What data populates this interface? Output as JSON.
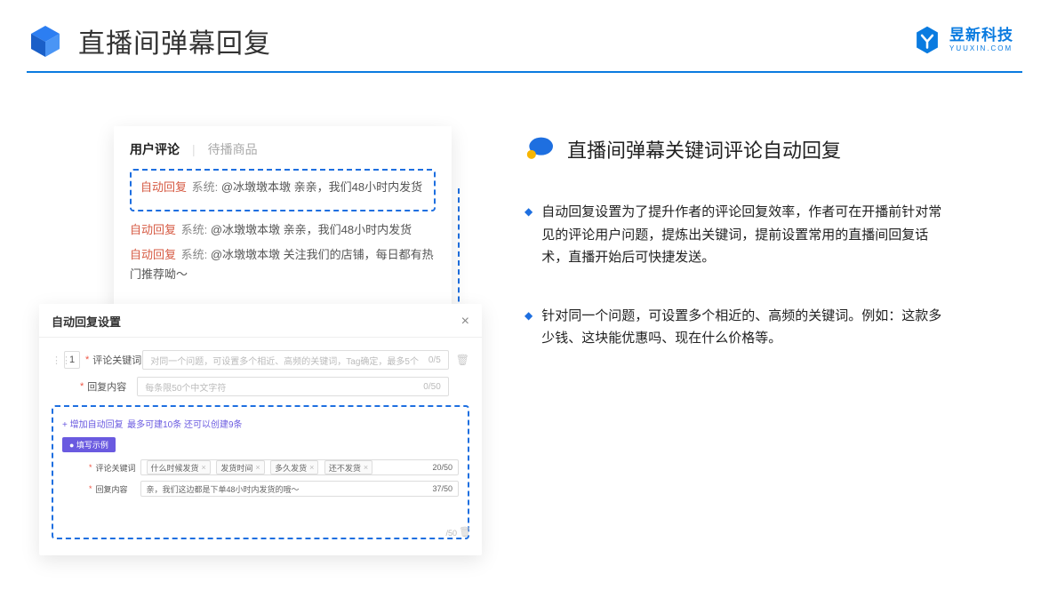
{
  "header": {
    "title": "直播间弹幕回复"
  },
  "brand": {
    "name": "昱新科技",
    "sub": "YUUXIN.COM"
  },
  "comments_card": {
    "tab_active": "用户评论",
    "tab_inactive": "待播商品",
    "highlighted": {
      "ar": "自动回复",
      "sys": " 系统: ",
      "text": "@冰墩墩本墩 亲亲，我们48小时内发货"
    },
    "line2": {
      "ar": "自动回复",
      "sys": " 系统: ",
      "text": "@冰墩墩本墩 亲亲，我们48小时内发货"
    },
    "line3": {
      "ar": "自动回复",
      "sys": " 系统: ",
      "text": "@冰墩墩本墩 关注我们的店铺，每日都有热门推荐呦～"
    }
  },
  "settings_card": {
    "title": "自动回复设置",
    "idx": "1",
    "kw_label": "评论关键词",
    "kw_placeholder": "对同一个问题，可设置多个相近、高频的关键词，Tag确定，最多5个",
    "kw_counter": "0/5",
    "content_label": "回复内容",
    "content_placeholder": "每条限50个中文字符",
    "content_counter": "0/50",
    "add_link": "+ 增加自动回复",
    "add_hint": "最多可建10条 还可以创建9条",
    "example_badge": "● 填写示例",
    "example_kw_label": "评论关键词",
    "example_tags": [
      "什么时候发货",
      "发货时间",
      "多久发货",
      "还不发货"
    ],
    "example_kw_counter": "20/50",
    "example_content_label": "回复内容",
    "example_content_value": "亲，我们这边都是下单48小时内发货的哦～",
    "example_content_counter": "37/50",
    "stray_counter": "/50"
  },
  "desc": {
    "title": "直播间弹幕关键词评论自动回复",
    "bullet1": "自动回复设置为了提升作者的评论回复效率，作者可在开播前针对常见的评论用户问题，提炼出关键词，提前设置常用的直播间回复话术，直播开始后可快捷发送。",
    "bullet2": "针对同一个问题，可设置多个相近的、高频的关键词。例如：这款多少钱、这块能优惠吗、现在什么价格等。"
  }
}
